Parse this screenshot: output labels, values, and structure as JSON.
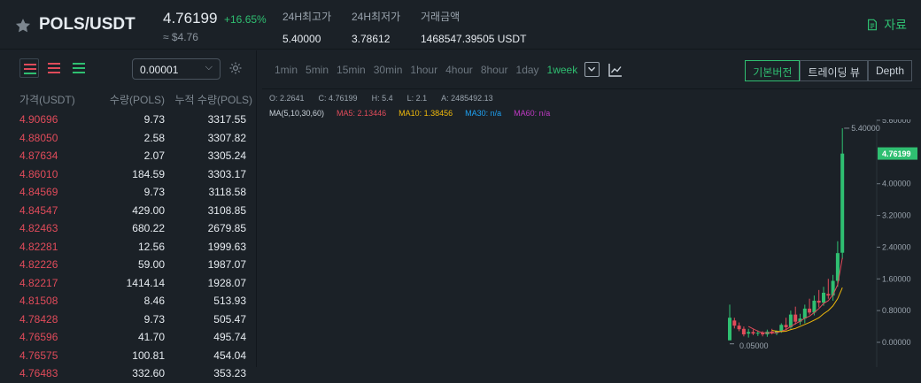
{
  "header": {
    "pair": "POLS/USDT",
    "price": "4.76199",
    "change": "+16.65%",
    "approx": "≈ $4.76",
    "stats": [
      {
        "label": "24H최고가",
        "value": "5.40000"
      },
      {
        "label": "24H최저가",
        "value": "3.78612"
      },
      {
        "label": "거래금액",
        "value": "1468547.39505 USDT"
      }
    ],
    "docs_label": "자료"
  },
  "colors": {
    "up": "#2fbf71",
    "down": "#e04b5a",
    "accent": "#2fbf71"
  },
  "orderbook": {
    "precision": "0.00001",
    "headers": {
      "price": "가격(USDT)",
      "qty": "수량(POLS)",
      "cum": "누적 수량(POLS)"
    },
    "asks": [
      {
        "price": "4.90696",
        "qty": "9.73",
        "cum": "3317.55"
      },
      {
        "price": "4.88050",
        "qty": "2.58",
        "cum": "3307.82"
      },
      {
        "price": "4.87634",
        "qty": "2.07",
        "cum": "3305.24"
      },
      {
        "price": "4.86010",
        "qty": "184.59",
        "cum": "3303.17"
      },
      {
        "price": "4.84569",
        "qty": "9.73",
        "cum": "3118.58"
      },
      {
        "price": "4.84547",
        "qty": "429.00",
        "cum": "3108.85"
      },
      {
        "price": "4.82463",
        "qty": "680.22",
        "cum": "2679.85"
      },
      {
        "price": "4.82281",
        "qty": "12.56",
        "cum": "1999.63"
      },
      {
        "price": "4.82226",
        "qty": "59.00",
        "cum": "1987.07"
      },
      {
        "price": "4.82217",
        "qty": "1414.14",
        "cum": "1928.07"
      },
      {
        "price": "4.81508",
        "qty": "8.46",
        "cum": "513.93"
      },
      {
        "price": "4.78428",
        "qty": "9.73",
        "cum": "505.47"
      },
      {
        "price": "4.76596",
        "qty": "41.70",
        "cum": "495.74"
      },
      {
        "price": "4.76575",
        "qty": "100.81",
        "cum": "454.04"
      },
      {
        "price": "4.76483",
        "qty": "332.60",
        "cum": "353.23"
      }
    ]
  },
  "chart": {
    "intervals": [
      "1min",
      "5min",
      "15min",
      "30min",
      "1hour",
      "4hour",
      "8hour",
      "1day",
      "1week"
    ],
    "active_interval": "1week",
    "views": [
      "기본버전",
      "트레이딩 뷰",
      "Depth"
    ],
    "ohlc": [
      "O: 2.2641",
      "C: 4.76199",
      "H: 5.4",
      "L: 2.1",
      "A: 2485492.13"
    ],
    "ma": {
      "label": "MA(5,10,30,60)",
      "ma5": "MA5: 2.13446",
      "ma10": "MA10: 1.38456",
      "ma30": "MA30: n/a",
      "ma60": "MA60: n/a"
    },
    "ma_colors": {
      "ma5": "#e04b5a",
      "ma10": "#f0b90b",
      "ma30": "#1ea1f2",
      "ma60": "#c039c4"
    },
    "y_ticks": [
      "5.60000",
      "4.00000",
      "3.20000",
      "2.40000",
      "1.60000",
      "0.80000",
      "0.00000"
    ],
    "y_tick_values": [
      5.6,
      4.0,
      3.2,
      2.4,
      1.6,
      0.8,
      0.0
    ],
    "last_price": "4.76199",
    "last_price_value": 4.76199,
    "max_label": "5.40000",
    "max_value": 5.4,
    "min_label": "0.05000",
    "min_value": 0.05,
    "candles": [
      {
        "o": 0.05,
        "h": 0.95,
        "l": 0.05,
        "c": 0.62
      },
      {
        "o": 0.55,
        "h": 0.62,
        "l": 0.35,
        "c": 0.42
      },
      {
        "o": 0.42,
        "h": 0.5,
        "l": 0.28,
        "c": 0.33
      },
      {
        "o": 0.34,
        "h": 0.4,
        "l": 0.15,
        "c": 0.2
      },
      {
        "o": 0.22,
        "h": 0.34,
        "l": 0.12,
        "c": 0.26
      },
      {
        "o": 0.26,
        "h": 0.32,
        "l": 0.18,
        "c": 0.22
      },
      {
        "o": 0.22,
        "h": 0.3,
        "l": 0.16,
        "c": 0.24
      },
      {
        "o": 0.24,
        "h": 0.28,
        "l": 0.15,
        "c": 0.2
      },
      {
        "o": 0.2,
        "h": 0.32,
        "l": 0.14,
        "c": 0.27
      },
      {
        "o": 0.27,
        "h": 0.34,
        "l": 0.2,
        "c": 0.23
      },
      {
        "o": 0.23,
        "h": 0.3,
        "l": 0.18,
        "c": 0.28
      },
      {
        "o": 0.28,
        "h": 0.48,
        "l": 0.24,
        "c": 0.44
      },
      {
        "o": 0.44,
        "h": 0.62,
        "l": 0.3,
        "c": 0.38
      },
      {
        "o": 0.38,
        "h": 0.8,
        "l": 0.34,
        "c": 0.7
      },
      {
        "o": 0.7,
        "h": 0.9,
        "l": 0.45,
        "c": 0.52
      },
      {
        "o": 0.52,
        "h": 0.72,
        "l": 0.44,
        "c": 0.6
      },
      {
        "o": 0.6,
        "h": 0.95,
        "l": 0.48,
        "c": 0.85
      },
      {
        "o": 0.85,
        "h": 1.1,
        "l": 0.7,
        "c": 0.75
      },
      {
        "o": 0.75,
        "h": 1.18,
        "l": 0.68,
        "c": 1.05
      },
      {
        "o": 1.05,
        "h": 1.32,
        "l": 0.88,
        "c": 1.0
      },
      {
        "o": 1.0,
        "h": 1.4,
        "l": 0.92,
        "c": 1.25
      },
      {
        "o": 1.22,
        "h": 1.6,
        "l": 1.1,
        "c": 1.18
      },
      {
        "o": 1.18,
        "h": 1.7,
        "l": 1.05,
        "c": 1.55
      },
      {
        "o": 1.55,
        "h": 2.55,
        "l": 1.4,
        "c": 2.25
      },
      {
        "o": 2.26,
        "h": 5.4,
        "l": 2.1,
        "c": 4.76
      }
    ],
    "ma5_values": [
      null,
      null,
      null,
      null,
      0.4,
      0.34,
      0.28,
      0.24,
      0.24,
      0.24,
      0.24,
      0.28,
      0.32,
      0.4,
      0.47,
      0.53,
      0.61,
      0.66,
      0.75,
      0.85,
      0.98,
      1.05,
      1.2,
      1.45,
      2.13
    ],
    "ma10_values": [
      null,
      null,
      null,
      null,
      null,
      null,
      null,
      null,
      null,
      0.3,
      0.28,
      0.27,
      0.28,
      0.32,
      0.35,
      0.4,
      0.45,
      0.5,
      0.56,
      0.62,
      0.72,
      0.8,
      0.92,
      1.1,
      1.38
    ]
  }
}
